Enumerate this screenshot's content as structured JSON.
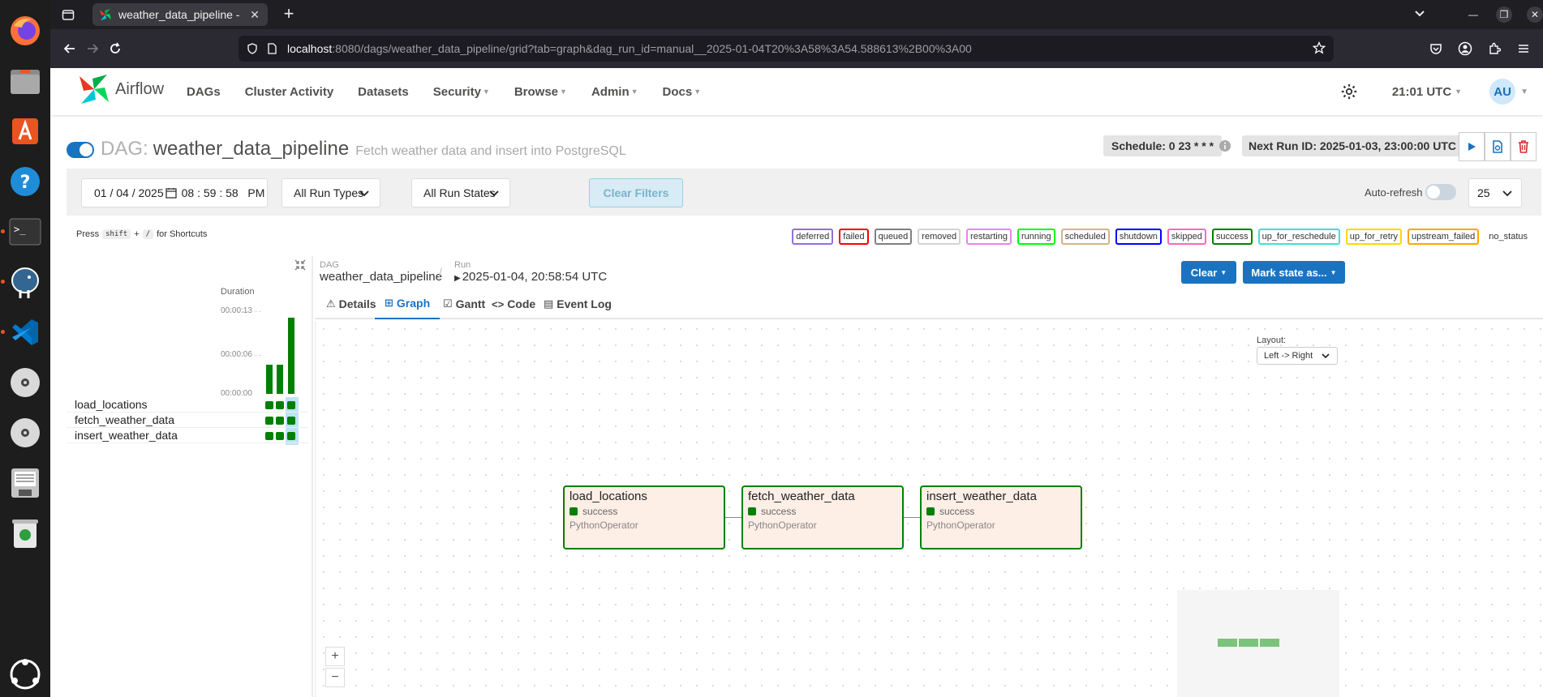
{
  "browser": {
    "tab_title": "weather_data_pipeline -",
    "url_host": "localhost",
    "url_rest": ":8080/dags/weather_data_pipeline/grid?tab=graph&dag_run_id=manual__2025-01-04T20%3A58%3A54.588613%2B00%3A00"
  },
  "header": {
    "brand": "Airflow",
    "menu": [
      {
        "label": "DAGs",
        "caret": false
      },
      {
        "label": "Cluster Activity",
        "caret": false
      },
      {
        "label": "Datasets",
        "caret": false
      },
      {
        "label": "Security",
        "caret": true
      },
      {
        "label": "Browse",
        "caret": true
      },
      {
        "label": "Admin",
        "caret": true
      },
      {
        "label": "Docs",
        "caret": true
      }
    ],
    "time": "21:01 UTC",
    "avatar": "AU"
  },
  "dag": {
    "prefix": "DAG:",
    "name": "weather_data_pipeline",
    "description": "Fetch weather data and insert into PostgreSQL",
    "schedule": "Schedule: 0 23 * * *",
    "next_run": "Next Run ID: 2025-01-03, 23:00:00 UTC",
    "paused": false
  },
  "filters": {
    "date": "01 / 04 / 2025",
    "time": "08 : 59 : 58   PM",
    "run_types": "All Run Types",
    "run_states": "All Run States",
    "clear_label": "Clear Filters",
    "auto_refresh": "Auto-refresh",
    "limit": "25"
  },
  "shortcuts": {
    "press": "Press",
    "key1": "shift",
    "plus": "+",
    "key2": "/",
    "suffix": "for Shortcuts"
  },
  "legend": [
    {
      "label": "deferred",
      "color": "#9370db"
    },
    {
      "label": "failed",
      "color": "#ff0000"
    },
    {
      "label": "queued",
      "color": "#808080"
    },
    {
      "label": "removed",
      "color": "#d3d3d3"
    },
    {
      "label": "restarting",
      "color": "#ee82ee"
    },
    {
      "label": "running",
      "color": "#00ff00"
    },
    {
      "label": "scheduled",
      "color": "#d2b48c"
    },
    {
      "label": "shutdown",
      "color": "#0000ff"
    },
    {
      "label": "skipped",
      "color": "#ff69b4"
    },
    {
      "label": "success",
      "color": "#008000"
    },
    {
      "label": "up_for_reschedule",
      "color": "#40e0d0"
    },
    {
      "label": "up_for_retry",
      "color": "#ffd700"
    },
    {
      "label": "upstream_failed",
      "color": "#ffa500"
    },
    {
      "label": "no_status",
      "color": "transparent"
    }
  ],
  "grid": {
    "duration_label": "Duration",
    "ticks": [
      "00:00:13",
      "00:00:06",
      "00:00:00"
    ],
    "run_durations_sec": [
      5,
      5,
      13
    ],
    "tasks": [
      "load_locations",
      "fetch_weather_data",
      "insert_weather_data"
    ]
  },
  "run_panel": {
    "dag_label": "DAG",
    "dag_value": "weather_data_pipeline",
    "run_label": "Run",
    "run_value": "2025-01-04, 20:58:54 UTC",
    "clear_btn": "Clear",
    "mark_btn": "Mark state as...",
    "tabs": [
      {
        "label": "Details",
        "icon": "⚠"
      },
      {
        "label": "Graph",
        "icon": "⊞"
      },
      {
        "label": "Gantt",
        "icon": "☑"
      },
      {
        "label": "Code",
        "icon": "<>"
      },
      {
        "label": "Event Log",
        "icon": "▤"
      }
    ],
    "active_tab": "Graph",
    "layout_label": "Layout:",
    "layout_value": "Left -> Right"
  },
  "graph_nodes": [
    {
      "name": "load_locations",
      "state": "success",
      "operator": "PythonOperator"
    },
    {
      "name": "fetch_weather_data",
      "state": "success",
      "operator": "PythonOperator"
    },
    {
      "name": "insert_weather_data",
      "state": "success",
      "operator": "PythonOperator"
    }
  ],
  "colors": {
    "success": "#008000",
    "accent": "#1a73c0"
  }
}
